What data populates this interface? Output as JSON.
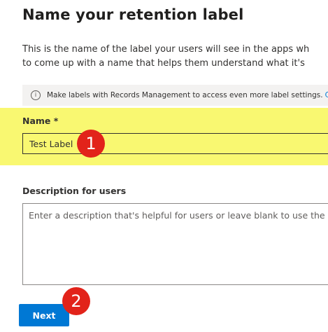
{
  "page": {
    "title": "Name your retention label",
    "description_lines": [
      "This is the name of the label your users will see in the apps wh",
      "to come up with a name that helps them understand what it's"
    ]
  },
  "info_bar": {
    "icon": "info-icon",
    "text": "Make labels with Records Management to access even more label settings.",
    "link_fragment": "C"
  },
  "name_field": {
    "label": "Name *",
    "value": "Test Label",
    "highlight_color": "#f9f871"
  },
  "description_field": {
    "label": "Description for users",
    "placeholder": "Enter a description that's helpful for users or leave blank to use the de"
  },
  "footer": {
    "next_label": "Next"
  },
  "annotations": {
    "marker_1": "1",
    "marker_2": "2",
    "marker_color": "#e2231a"
  },
  "colors": {
    "accent": "#0078d4",
    "text": "#323130"
  }
}
